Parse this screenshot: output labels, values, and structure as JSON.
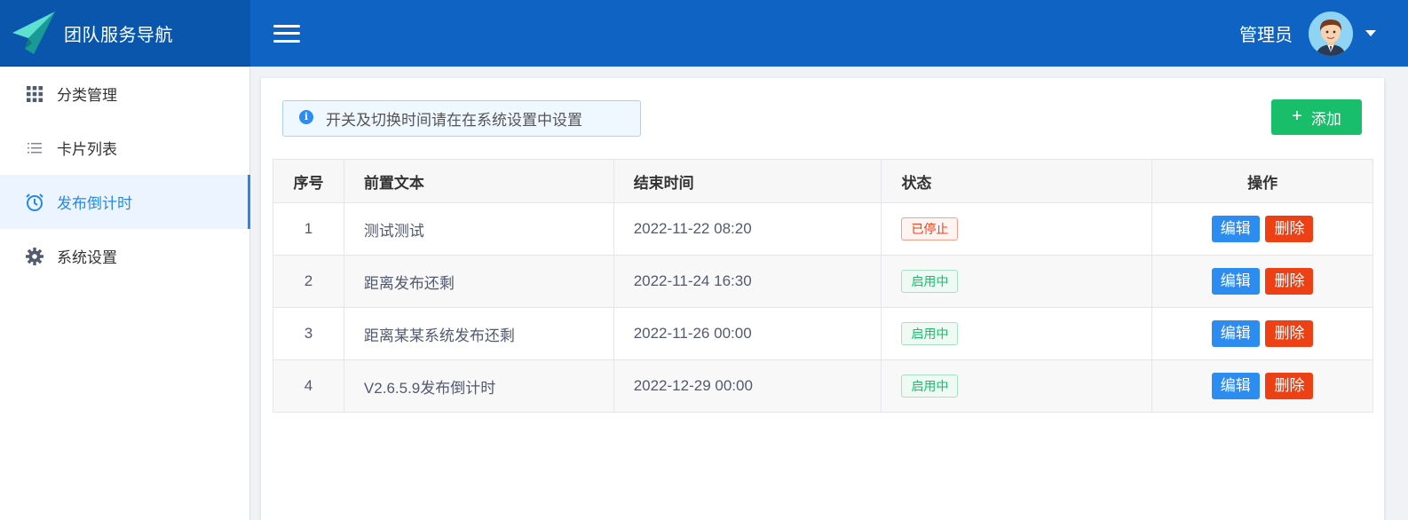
{
  "header": {
    "brand_name": "团队服务导航",
    "user_name": "管理员"
  },
  "sidebar": {
    "items": [
      {
        "label": "分类管理",
        "icon": "grid-icon"
      },
      {
        "label": "卡片列表",
        "icon": "list-icon"
      },
      {
        "label": "发布倒计时",
        "icon": "alarm-clock-icon",
        "active": true
      },
      {
        "label": "系统设置",
        "icon": "gear-icon"
      }
    ]
  },
  "main": {
    "notice": "开关及切换时间请在在系统设置中设置",
    "add_label": "添加",
    "table": {
      "headers": [
        "序号",
        "前置文本",
        "结束时间",
        "状态",
        "操作"
      ],
      "rows": [
        {
          "index": "1",
          "text": "测试测试",
          "end_time": "2022-11-22 08:20",
          "status": "已停止"
        },
        {
          "index": "2",
          "text": "距离发布还剩",
          "end_time": "2022-11-24 16:30",
          "status": "启用中"
        },
        {
          "index": "3",
          "text": "距离某某系统发布还剩",
          "end_time": "2022-11-26 00:00",
          "status": "启用中"
        },
        {
          "index": "4",
          "text": "V2.6.5.9发布倒计时",
          "end_time": "2022-12-29 00:00",
          "status": "启用中"
        }
      ],
      "edit_label": "编辑",
      "delete_label": "删除"
    }
  },
  "colors": {
    "header_bg": "#0f64c3",
    "accent": "#2688ea",
    "success": "#19be6b",
    "danger": "#ed4014"
  }
}
